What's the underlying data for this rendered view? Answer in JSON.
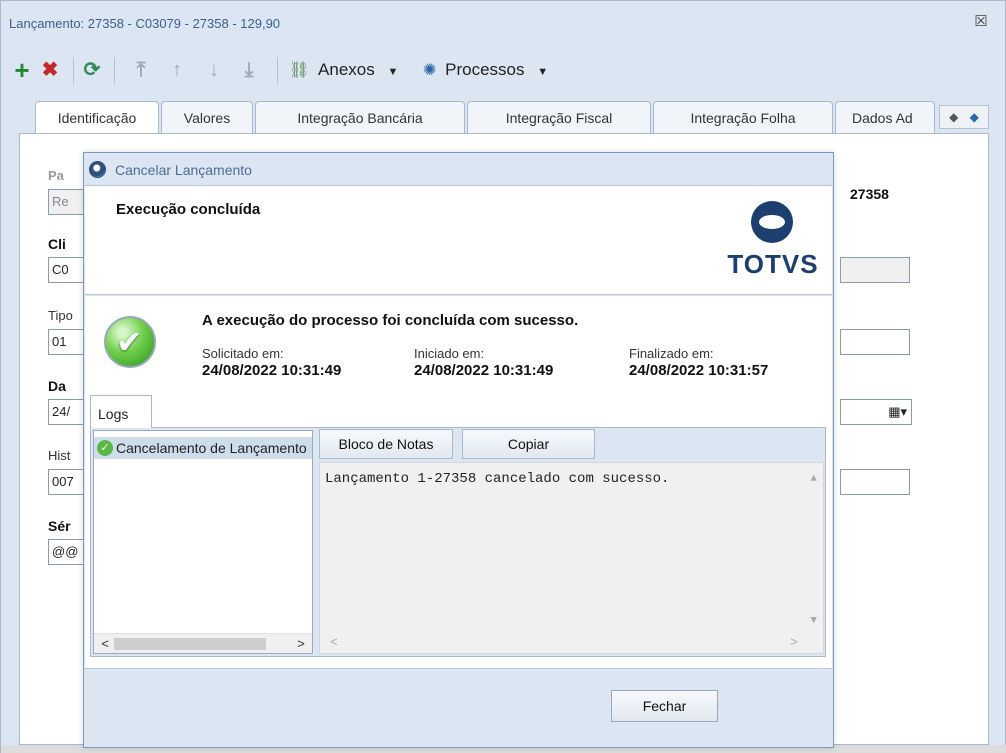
{
  "window": {
    "title": "Lançamento: 27358 - C03079 - 27358 - 129,90",
    "close_glyph": "☒"
  },
  "toolbar": {
    "add_glyph": "+",
    "delete_glyph": "✖",
    "refresh_glyph": "⟳",
    "first_glyph": "⤒",
    "prev_glyph": "↑",
    "next_glyph": "↓",
    "last_glyph": "⤓",
    "attachments_glyph": "⛓",
    "attachments_label": "Anexos",
    "processes_glyph": "✺",
    "processes_label": "Processos",
    "caret_glyph": "▼",
    "colors": {
      "add": "#1f8a2d",
      "delete": "#c62828",
      "nav": "#9aa9bb"
    }
  },
  "tabs": [
    {
      "label": "Identificação",
      "active": true
    },
    {
      "label": "Valores"
    },
    {
      "label": "Integração Bancária"
    },
    {
      "label": "Integração Fiscal"
    },
    {
      "label": "Integração Folha"
    },
    {
      "label": "Dados Ad"
    }
  ],
  "tab_arrows": {
    "left": "◆",
    "right": "◆"
  },
  "form_fragments": {
    "pa_label": "Pa",
    "re_value": "Re",
    "cli_label": "Cli",
    "c0_value": "C0",
    "tip_label": "Tipo",
    "tip_value": "01",
    "dat_label": "Da",
    "dat_value": "24/",
    "his_label": "Hist",
    "his_value": "007",
    "ser_label": "Sér",
    "ser_value": "@@",
    "ref_value": "27358",
    "cal_glyph": "▦▾"
  },
  "dialog": {
    "title": "Cancelar Lançamento",
    "header_title": "Execução concluída",
    "logo_text": "TOTVS",
    "message": "A execução do processo foi concluída com sucesso.",
    "requested_label": "Solicitado em:",
    "requested_value": "24/08/2022 10:31:49",
    "started_label": "Iniciado em:",
    "started_value": "24/08/2022 10:31:49",
    "finished_label": "Finalizado em:",
    "finished_value": "24/08/2022 10:31:57",
    "logs_tab": "Logs",
    "tree_item": "Cancelamento de Lançamento",
    "notepad_button": "Bloco de Notas",
    "copy_button": "Copiar",
    "log_text": "Lançamento 1-27358 cancelado com sucesso.",
    "close_button": "Fechar",
    "scroll_left": "<",
    "scroll_right": ">",
    "scroll_up": "▲",
    "scroll_down": "▼"
  }
}
